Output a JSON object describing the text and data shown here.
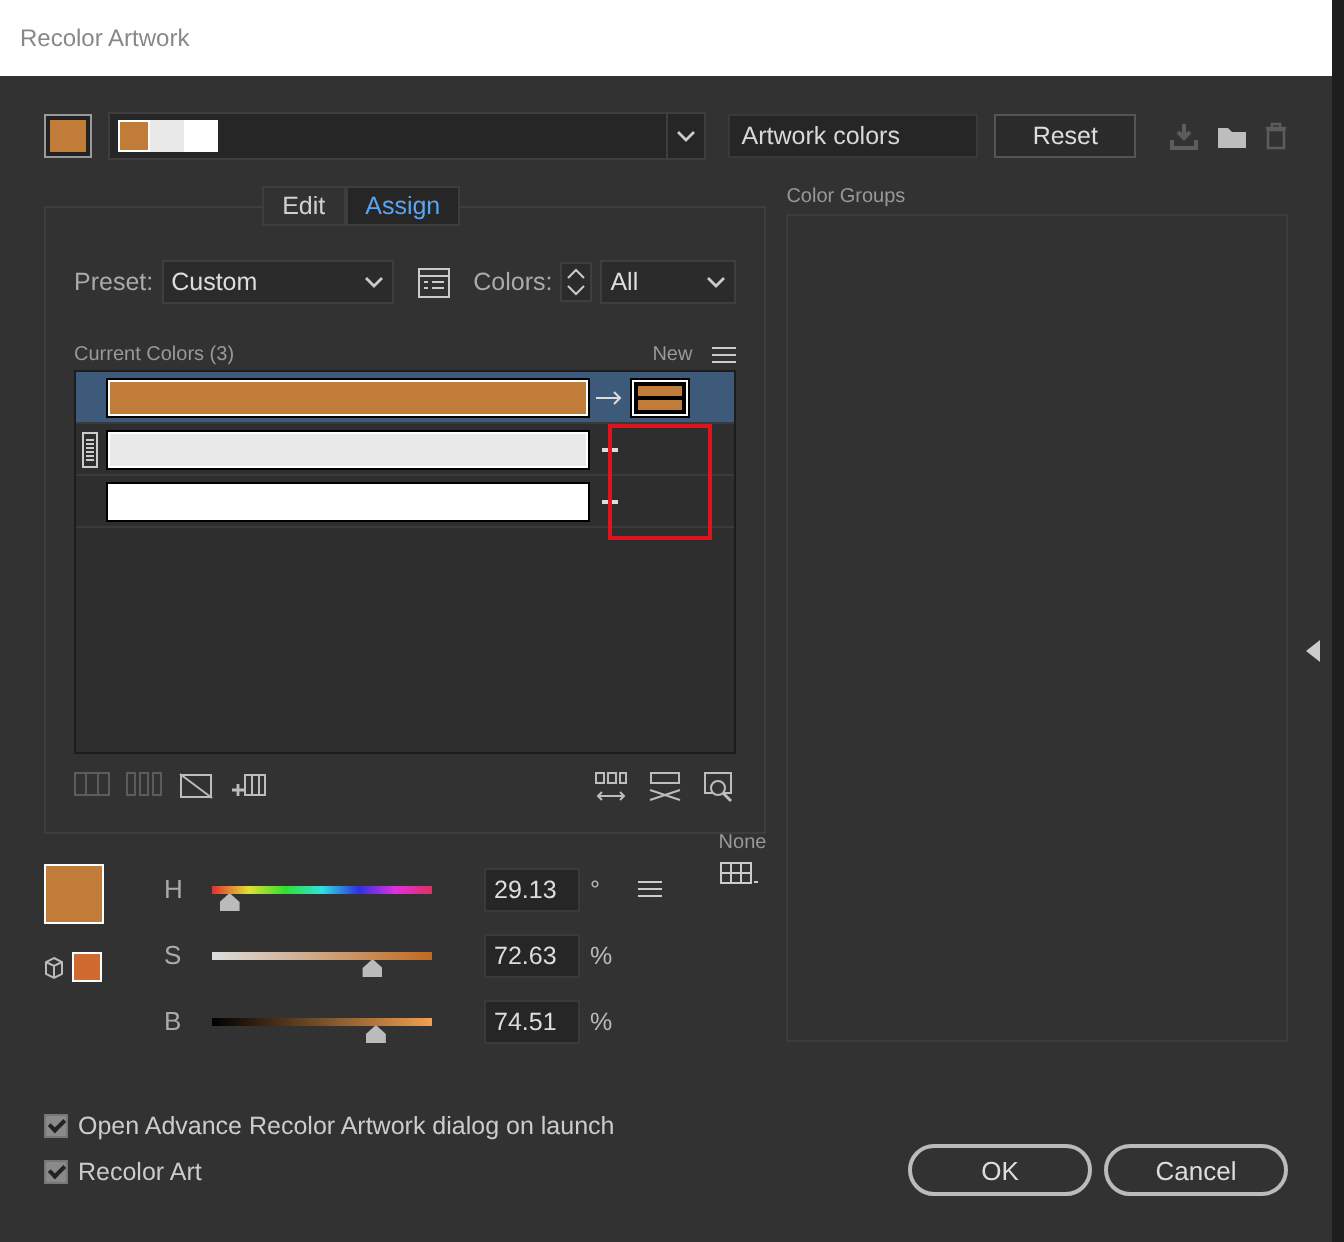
{
  "window": {
    "title": "Recolor Artwork"
  },
  "top": {
    "group_swatches": [
      {
        "color": "#c17c3a"
      },
      {
        "color": "#e9e9e9"
      },
      {
        "color": "#ffffff"
      }
    ],
    "group_name": "Artwork colors",
    "reset": "Reset"
  },
  "tabs": [
    {
      "label": "Edit",
      "selected": false
    },
    {
      "label": "Assign",
      "selected": true
    }
  ],
  "preset": {
    "label": "Preset:",
    "value": "Custom"
  },
  "colors": {
    "label": "Colors:",
    "value": "All"
  },
  "current_colors": {
    "label": "Current Colors (3)",
    "new_label": "New",
    "rows": [
      {
        "color": "#c17c3a",
        "new_swatches": [
          {
            "color": "#c17c3a"
          }
        ],
        "selected": true,
        "grouped": false
      },
      {
        "color": "#e9e9e9",
        "new_swatches": [],
        "selected": false,
        "grouped": true
      },
      {
        "color": "#ffffff",
        "new_swatches": [],
        "selected": false,
        "grouped": false
      }
    ]
  },
  "hsb": {
    "swatches": [
      {
        "kind": "fill",
        "color": "#c17c3a"
      },
      {
        "kind": "gamut",
        "color": "#d06a30"
      }
    ],
    "none_label": "None",
    "sliders": [
      {
        "label": "H",
        "value": "29.13",
        "unit": "°",
        "level": 0.08,
        "kind": "hue"
      },
      {
        "label": "S",
        "value": "72.63",
        "unit": "%",
        "level": 0.73,
        "kind": "saturation"
      },
      {
        "label": "B",
        "value": "74.51",
        "unit": "%",
        "level": 0.745,
        "kind": "brightness"
      }
    ]
  },
  "color_groups": {
    "label": "Color Groups"
  },
  "options": [
    {
      "label": "Open Advance Recolor Artwork dialog on launch",
      "checked": true
    },
    {
      "label": "Recolor Art",
      "checked": true
    }
  ],
  "buttons": [
    {
      "label": "OK"
    },
    {
      "label": "Cancel"
    }
  ]
}
